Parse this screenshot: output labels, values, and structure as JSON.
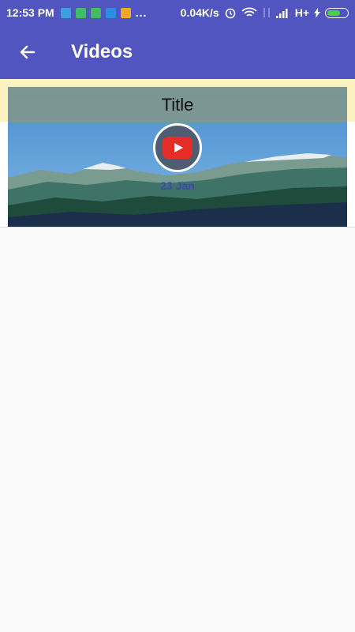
{
  "status_bar": {
    "time": "12:53 PM",
    "dots": "...",
    "speed": "0.04K/s",
    "network": "H+"
  },
  "app_bar": {
    "back_icon": "arrow-left",
    "title": "Videos"
  },
  "video_card": {
    "title": "Title",
    "date": "23 Jan",
    "play_icon": "youtube-play-icon"
  },
  "colors": {
    "primary": "#5055bf",
    "accent_strip": "#fbf1c1",
    "youtube_red": "#e52d27"
  }
}
